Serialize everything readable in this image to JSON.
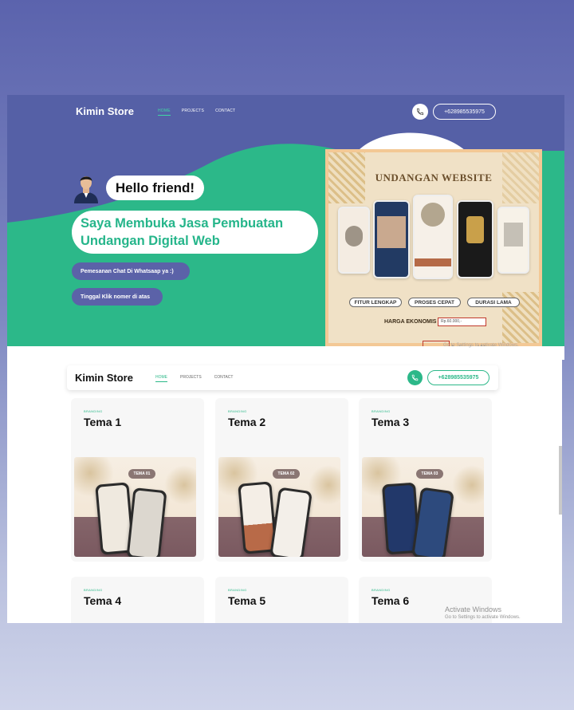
{
  "hero": {
    "brand": "Kimin Store",
    "nav": [
      "HOME",
      "PROJECTS",
      "CONTACT"
    ],
    "phone": "+628985535975",
    "greeting": "Hello friend!",
    "headline_line1": "Saya Membuka Jasa Pembuatan",
    "headline_line2": "Undangan Digital Web",
    "chip1": "Pemesanan Chat Di Whatsaap ya :)",
    "chip2": "Tinggal Klik nomer di atas",
    "poster": {
      "title": "UNDANGAN WEBSITE",
      "tags": [
        "FITUR LENGKAP",
        "PROSES CEPAT",
        "DURASI LAMA"
      ],
      "harga_label": "HARGA EKONOMIS",
      "price": "Rp.60.000,-"
    }
  },
  "lower": {
    "brand": "Kimin Store",
    "nav": [
      "HOME",
      "PROJECTS",
      "CONTACT"
    ],
    "phone": "+628985535975",
    "cards": [
      {
        "category": "BRANDING",
        "title": "Tema 1",
        "badge": "TEMA 01"
      },
      {
        "category": "BRANDING",
        "title": "Tema 2",
        "badge": "TEMA 02"
      },
      {
        "category": "BRANDING",
        "title": "Tema 3",
        "badge": "TEMA 03"
      },
      {
        "category": "BRANDING",
        "title": "Tema 4"
      },
      {
        "category": "BRANDING",
        "title": "Tema 5"
      },
      {
        "category": "BRANDING",
        "title": "Tema 6"
      }
    ]
  },
  "watermark": {
    "title": "Activate Windows",
    "subtitle": "Go to Settings to activate Windows."
  },
  "colors": {
    "hero_purple": "#5560a6",
    "hero_green": "#2cb889",
    "accent_green": "#2cb889"
  }
}
